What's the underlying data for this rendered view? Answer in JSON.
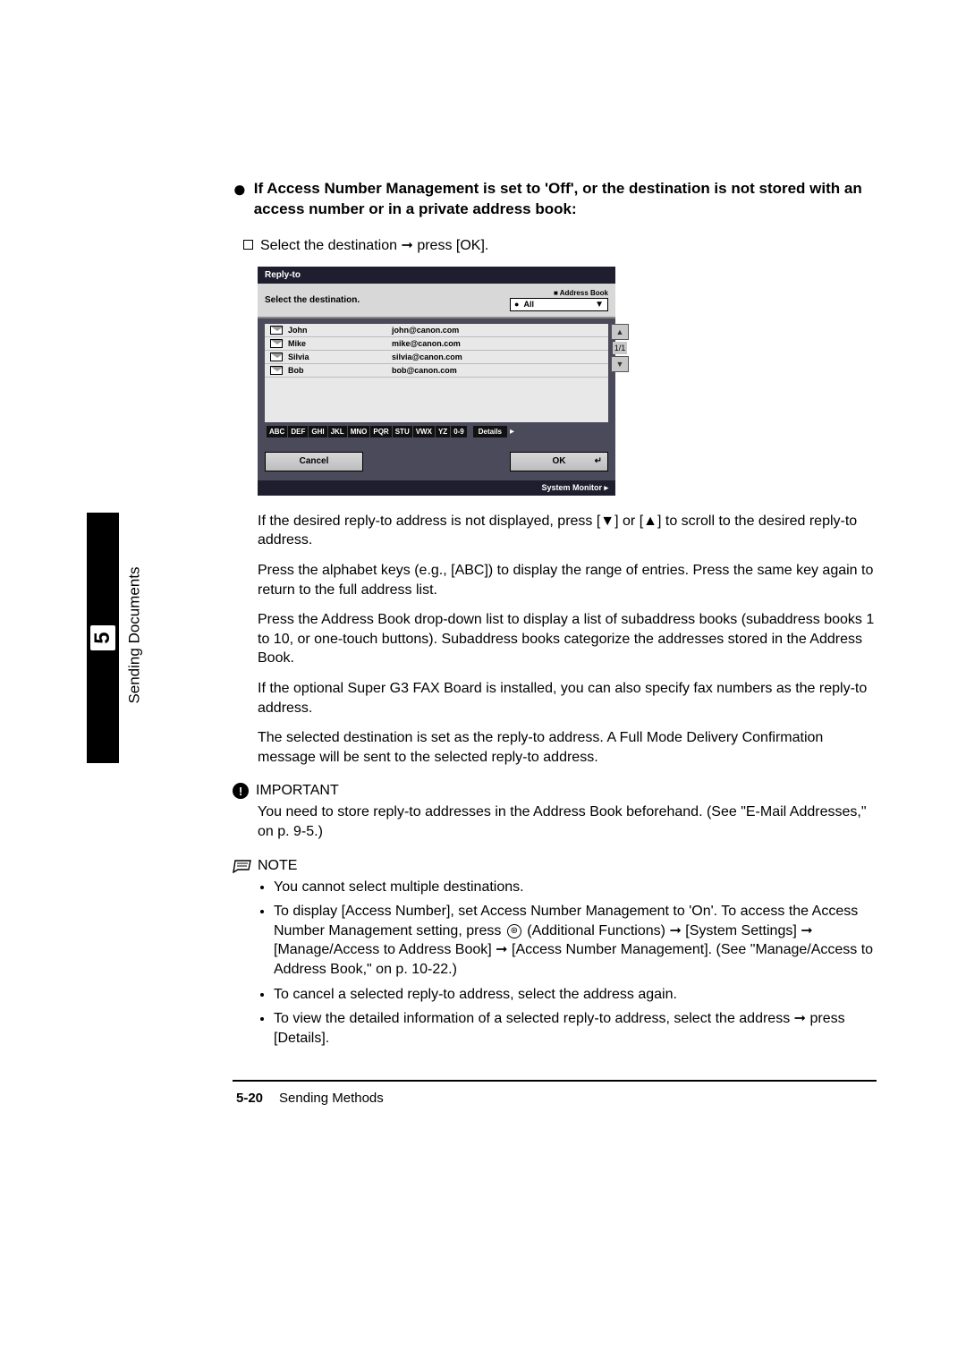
{
  "side": {
    "chapter_number": "5",
    "chapter_label": "Sending Documents"
  },
  "heading": "If Access Number Management is set to 'Off', or the destination is not stored with an access number or in a private address book:",
  "substep": {
    "prefix": "Select the destination",
    "arrow": "➞",
    "suffix": "press [OK]."
  },
  "screenshot": {
    "title": "Reply-to",
    "instruction": "Select the destination.",
    "dropdown_top": "Address Book",
    "dropdown_bullet": "●",
    "dropdown_value": "All",
    "rows": [
      {
        "name": "John",
        "email": "john@canon.com"
      },
      {
        "name": "Mike",
        "email": "mike@canon.com"
      },
      {
        "name": "Silvia",
        "email": "silvia@canon.com"
      },
      {
        "name": "Bob",
        "email": "bob@canon.com"
      }
    ],
    "pager": "1/1",
    "alpha": [
      "ABC",
      "DEF",
      "GHI",
      "JKL",
      "MNO",
      "PQR",
      "STU",
      "VWX",
      "YZ",
      "0-9"
    ],
    "details": "Details",
    "cancel": "Cancel",
    "ok": "OK",
    "sysmon": "System Monitor"
  },
  "paras": {
    "p1": "If the desired reply-to address is not displayed, press [▼] or [▲] to scroll to the desired reply-to address.",
    "p2": "Press the alphabet keys (e.g., [ABC]) to display the range of entries. Press the same key again to return to the full address list.",
    "p3": "Press the Address Book drop-down list to display a list of subaddress books (subaddress books 1 to 10, or one-touch buttons). Subaddress books categorize the addresses stored in the Address Book.",
    "p4": "If the optional Super G3 FAX Board is installed, you can also specify fax numbers as the reply-to address.",
    "p5": "The selected destination is set as the reply-to address. A Full Mode Delivery Confirmation message will be sent to the selected reply-to address."
  },
  "important": {
    "label": "IMPORTANT",
    "body": "You need to store reply-to addresses in the Address Book beforehand. (See \"E-Mail Addresses,\" on p. 9-5.)"
  },
  "note": {
    "label": "NOTE",
    "items": {
      "n1": "You cannot select multiple destinations.",
      "n2a": "To display [Access Number], set Access Number Management to 'On'. To access the Access Number Management setting, press ",
      "n2b": " (Additional Functions) ",
      "n2c": " [System Settings] ",
      "n2d": " [Manage/Access to Address Book] ",
      "n2e": " [Access Number Management]. (See \"Manage/Access to Address Book,\" on p. 10-22.)",
      "n3": "To cancel a selected reply-to address, select the address again.",
      "n4a": "To view the detailed information of a selected reply-to address, select the address ",
      "n4b": " press [Details]."
    },
    "arrow": "➞",
    "circ_icon": "⊛"
  },
  "footer": {
    "page": "5-20",
    "section": "Sending Methods"
  }
}
